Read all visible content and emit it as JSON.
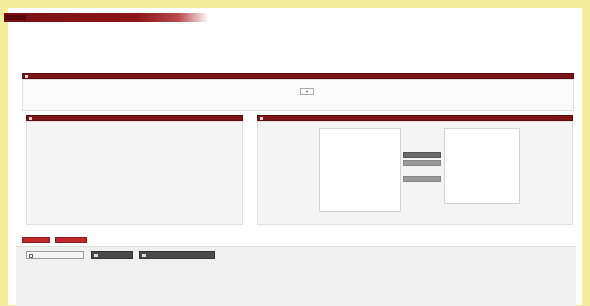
{
  "header": {
    "breadcrumb_text": "",
    "brand_title": ""
  },
  "page": {
    "title": "",
    "row_left": "",
    "row_right": ""
  },
  "panels": {
    "top_header": "",
    "left_header": "",
    "right_header": "",
    "select_label": "",
    "select_value": ""
  },
  "transfer": {
    "available_options": [],
    "move_buttons": [
      "",
      "",
      ""
    ]
  },
  "bottom": {
    "tab_a": "",
    "tab_b": "",
    "button_1": "",
    "button_2": "",
    "button_3": "",
    "label": ""
  },
  "colors": {
    "brand": "#7a0f10",
    "accent": "#c2282a",
    "background": "#f2ec9c"
  }
}
